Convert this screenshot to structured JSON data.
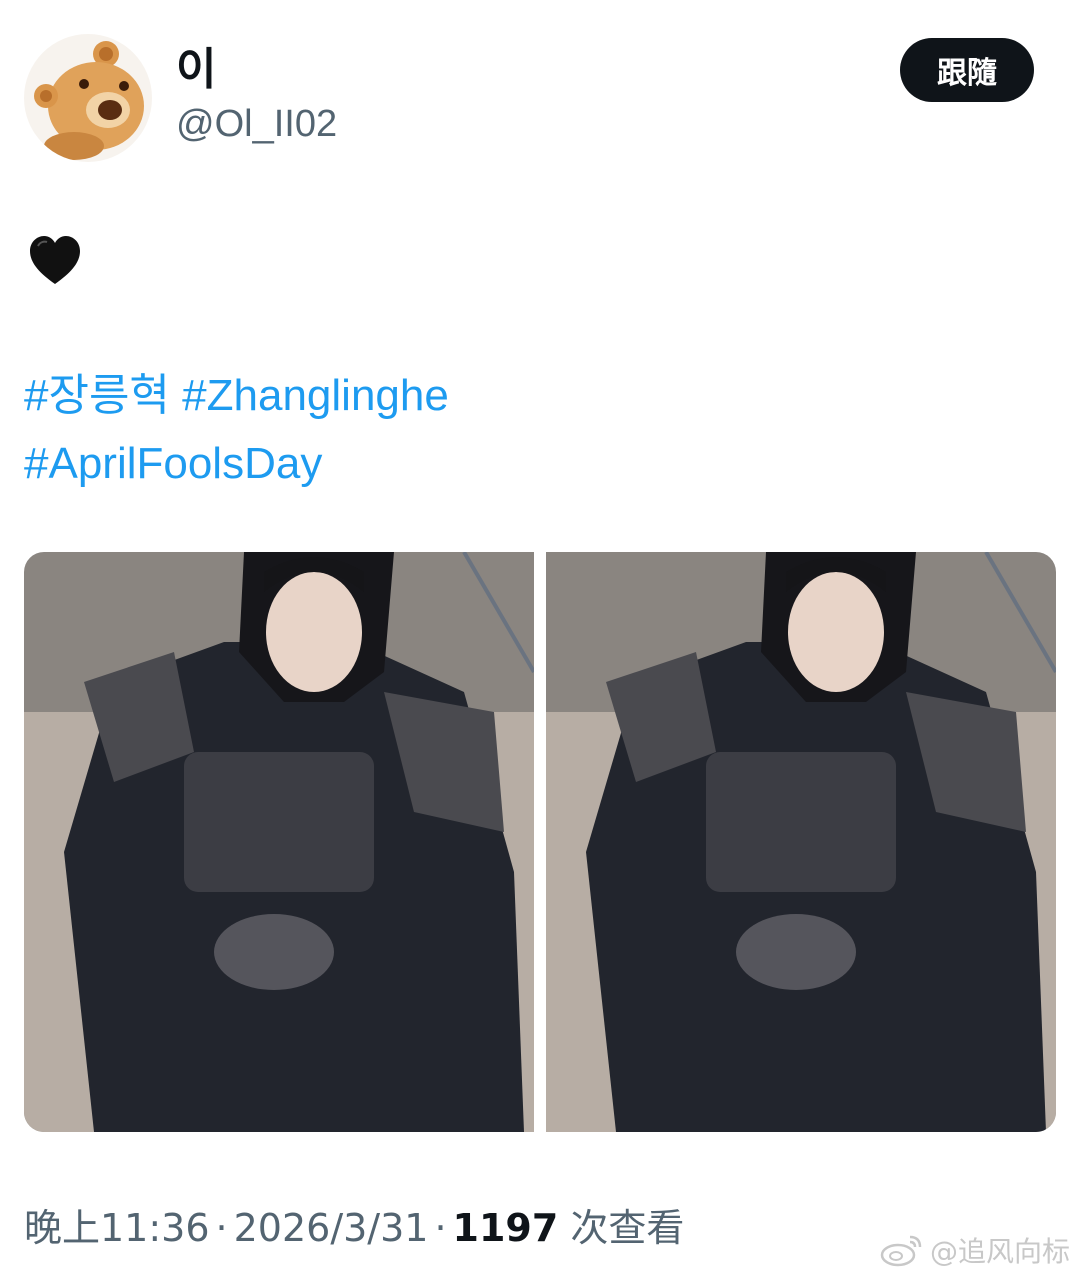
{
  "user": {
    "display_name": "이",
    "handle": "@Ol_II02",
    "avatar_icon": "teddy-bear-avatar"
  },
  "follow_button": {
    "label": "跟隨"
  },
  "tweet": {
    "emoji": "black-heart",
    "hashtags": [
      "#장릉혁",
      "#Zhanglinghe",
      "#AprilFoolsDay"
    ],
    "photos": [
      {
        "alt_icon": "photo-man-in-armor"
      },
      {
        "alt_icon": "photo-man-in-armor"
      }
    ]
  },
  "meta": {
    "time": "晚上11:36",
    "separator": "·",
    "date": "2026/3/31",
    "views_count": "1197",
    "views_label": "次查看"
  },
  "watermark": {
    "text": "@追风向标",
    "icon": "weibo-icon"
  },
  "colors": {
    "link": "#1d9bf0",
    "secondary_text": "#536471",
    "button_bg": "#0f1419"
  }
}
